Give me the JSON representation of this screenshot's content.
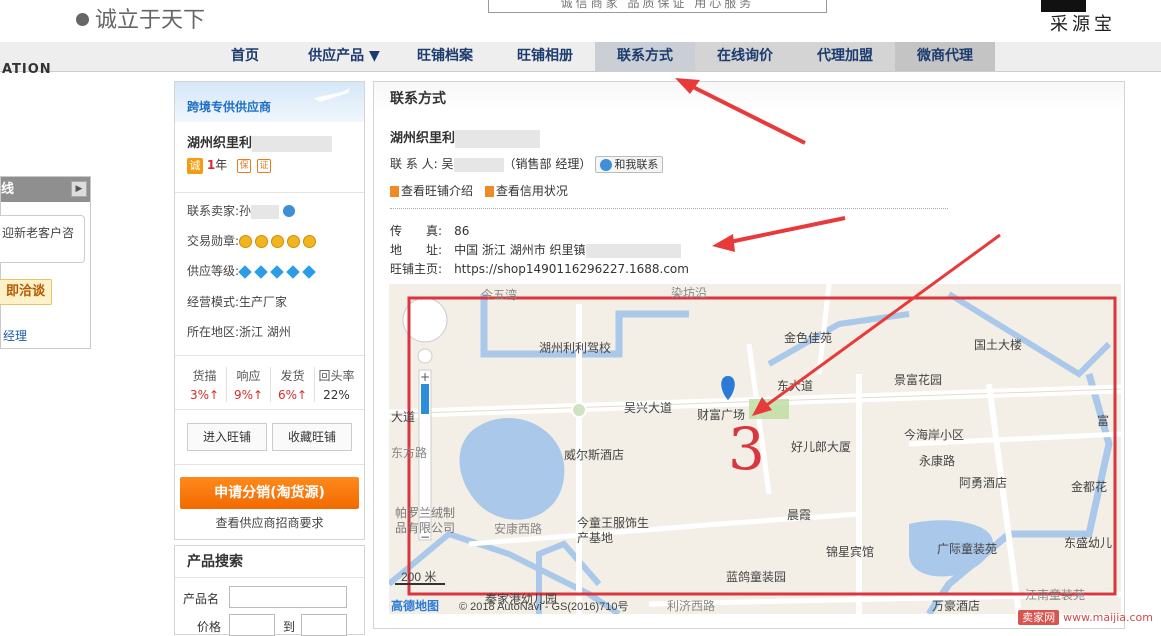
{
  "header": {
    "slogan": "诚立于天下",
    "promo": "诚信商家 品质保证 用心服务",
    "logo_text": "采源宝"
  },
  "nav": {
    "left_label": "ATION",
    "items": [
      {
        "label": "首页"
      },
      {
        "label": "供应产品 ▼"
      },
      {
        "label": "旺铺档案"
      },
      {
        "label": "旺铺相册"
      },
      {
        "label": "联系方式"
      },
      {
        "label": "在线询价"
      },
      {
        "label": "代理加盟"
      },
      {
        "label": "微商代理"
      }
    ]
  },
  "left_panel": {
    "header_label": "线",
    "greeting": "迎新老客户咨",
    "chat_label": "即洽谈",
    "manager_label": "经理"
  },
  "sidebar": {
    "banner": "跨境专供供应商",
    "company": "湖州织里利",
    "cheng_icon": "诚",
    "years_value": "1",
    "years_unit": "年",
    "contact_label": "联系卖家:",
    "contact_partial": "孙",
    "medal_label": "交易勋章:",
    "level_label": "供应等级:",
    "mode_label": "经营模式:",
    "mode_value": "生产厂家",
    "region_label": "所在地区:",
    "region_value": "浙江 湖州",
    "stats": [
      {
        "label": "货描",
        "value": "3%↑"
      },
      {
        "label": "响应",
        "value": "9%↑"
      },
      {
        "label": "发货",
        "value": "6%↑"
      },
      {
        "label": "回头率",
        "value": "22%"
      }
    ],
    "enter_shop": "进入旺铺",
    "fav_shop": "收藏旺铺",
    "apply_button": "申请分销(淘货源)",
    "apply_sub": "查看供应商招商要求"
  },
  "search": {
    "title": "产品搜索",
    "name_label": "产品名",
    "price_label": "价格",
    "to_label": "到"
  },
  "main": {
    "title": "联系方式",
    "company": "湖州织里利",
    "contact_label": "联 系 人:",
    "contact_partial": "吴",
    "contact_role": "（销售部 经理）",
    "chat_button": "和我联系",
    "link1": "查看旺铺介绍",
    "link2": "查看信用状况",
    "fax_label": "传　　真:",
    "fax_value": "86",
    "addr_label": "地　　址:",
    "addr_value": "中国 浙江 湖州市 织里镇",
    "shop_label": "旺铺主页:",
    "shop_value": "https://shop1490116296227.1688.com"
  },
  "map": {
    "labels": {
      "l1": "湖州利利驾校",
      "l2": "金色佳苑",
      "l3": "国土大楼",
      "l4": "景富花园",
      "l5": "吴兴大道",
      "l6": "财富广场",
      "l7": "好儿郎大厦",
      "l8": "今海岸小区",
      "l9": "永康路",
      "l10": "威尔斯酒店",
      "l11": "阿勇酒店",
      "l12": "金都花",
      "l13": "今童王服饰生产基地",
      "l14": "帕罗兰绒制品有限公司",
      "l15": "晨霞",
      "l16": "安康西路",
      "l17": "锦星宾馆",
      "l18": "广际童装苑",
      "l19": "东盛幼儿",
      "l20": "蓝鸽童装园",
      "l21": "万豪酒店",
      "l22": "富",
      "l23": "大道",
      "l24": "利济西路",
      "l25": "江南童装苑",
      "l26": "东方路",
      "l27": "今五湾",
      "l28": "染坊沿",
      "l29": "秦家港幼儿园",
      "l30": "东大道"
    },
    "scale": "200 米",
    "copyright": "© 2018 AutoNavi - GS(2016)710号",
    "provider": "高德地图"
  },
  "annotation": {
    "handwritten": "3"
  },
  "watermark": {
    "badge": "卖家网",
    "site": "www.maijia.com"
  }
}
